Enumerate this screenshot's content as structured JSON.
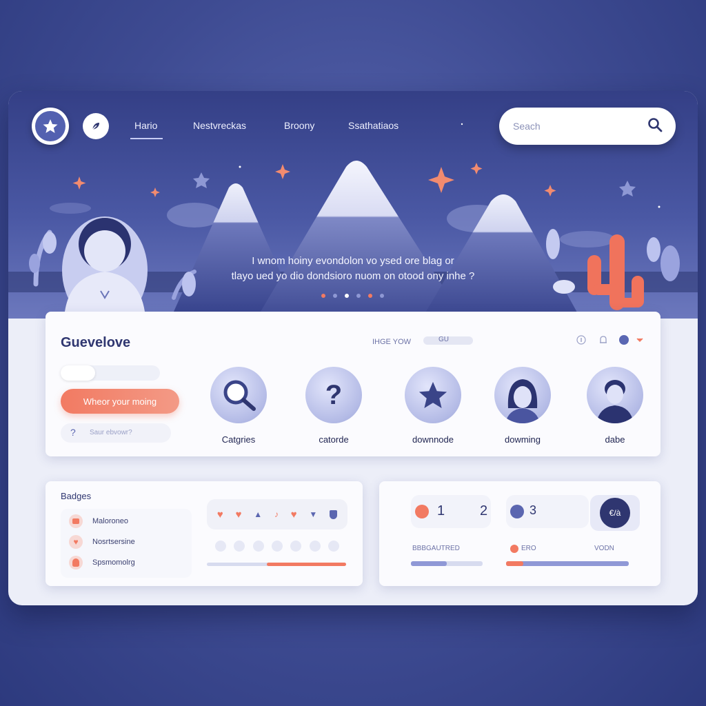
{
  "nav": {
    "links": [
      "Hario",
      "Nestvreckas",
      "Broony",
      "Ssathatiaos"
    ],
    "active_index": 0
  },
  "search": {
    "placeholder": "Seach"
  },
  "hero": {
    "line1": "I wnom hoiny evondolon vo ysed ore blag or",
    "line2": "tlayo ued yo dio dondsioro nuom on otood ony inhe ?",
    "slide_count": 6,
    "active_slide": 3
  },
  "main_card": {
    "title": "Guevelove",
    "filter_label": "IHGE YOW",
    "filter_value": "GU",
    "cta_button": "Wheor your moing",
    "help_text": "Saur ebvowr?",
    "categories": [
      {
        "label": "Catgries",
        "icon": "magnifier-icon"
      },
      {
        "label": "catorde",
        "icon": "question-icon"
      },
      {
        "label": "downnode",
        "icon": "star-icon"
      },
      {
        "label": "dowming",
        "icon": "woman-avatar-icon"
      },
      {
        "label": "dabe",
        "icon": "man-avatar-icon"
      }
    ]
  },
  "badges_card": {
    "title": "Badges",
    "items": [
      "Maloroneo",
      "Nosrtsersine",
      "Spsmomolrg"
    ],
    "strip_icons": [
      "heart",
      "heart",
      "pin",
      "music-note",
      "heart",
      "pin",
      "shield"
    ],
    "strip2_icons": [
      "cloud",
      "cloud",
      "tag",
      "bird",
      "cloud",
      "bulb",
      "tag"
    ],
    "progress": 0.57
  },
  "stats_card": {
    "step1": "1",
    "step2": "2",
    "step3": "3",
    "button_label": "€/à",
    "left_label": "BBBGAUTRED",
    "mid_label": "ERO",
    "right_label": "VODN",
    "progress_left": 0.5,
    "progress_right": 0.14
  },
  "colors": {
    "accent": "#f27a62",
    "brand": "#4a58a4",
    "navy": "#2f3670"
  }
}
